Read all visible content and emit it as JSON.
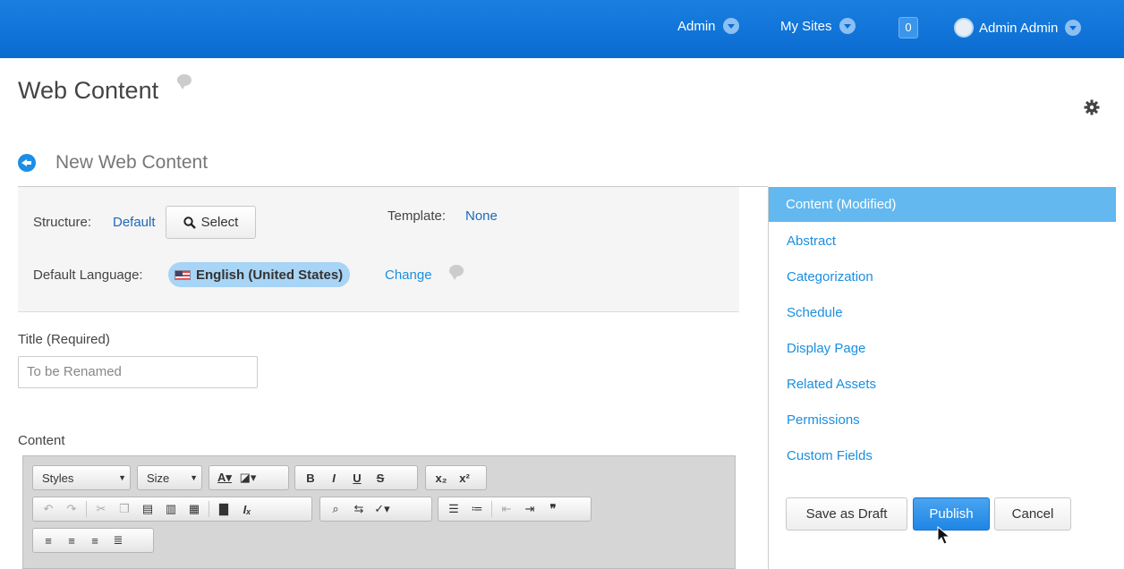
{
  "topbar": {
    "admin_menu": "Admin",
    "my_sites_menu": "My Sites",
    "notification_count": "0",
    "user_name": "Admin Admin"
  },
  "page": {
    "title": "Web Content",
    "section_title": "New Web Content"
  },
  "structure": {
    "structure_label": "Structure:",
    "structure_value": "Default",
    "select_button": "Select",
    "template_label": "Template:",
    "template_value": "None",
    "language_label": "Default Language:",
    "language_value": "English (United States)",
    "change_link": "Change"
  },
  "form": {
    "title_label": "Title (Required)",
    "title_value": "To be Renamed",
    "content_label": "Content"
  },
  "editor": {
    "styles_combo": "Styles",
    "size_combo": "Size"
  },
  "sidebar": {
    "items": [
      {
        "label": "Content (Modified)",
        "active": true
      },
      {
        "label": "Abstract"
      },
      {
        "label": "Categorization"
      },
      {
        "label": "Schedule"
      },
      {
        "label": "Display Page"
      },
      {
        "label": "Related Assets"
      },
      {
        "label": "Permissions"
      },
      {
        "label": "Custom Fields"
      }
    ]
  },
  "actions": {
    "save_draft": "Save as Draft",
    "publish": "Publish",
    "cancel": "Cancel"
  },
  "colors": {
    "topbar": "#0a6bd1",
    "accent": "#1a8fe0",
    "active_nav": "#62b8ef",
    "publish_button": "#2a8ee9"
  }
}
